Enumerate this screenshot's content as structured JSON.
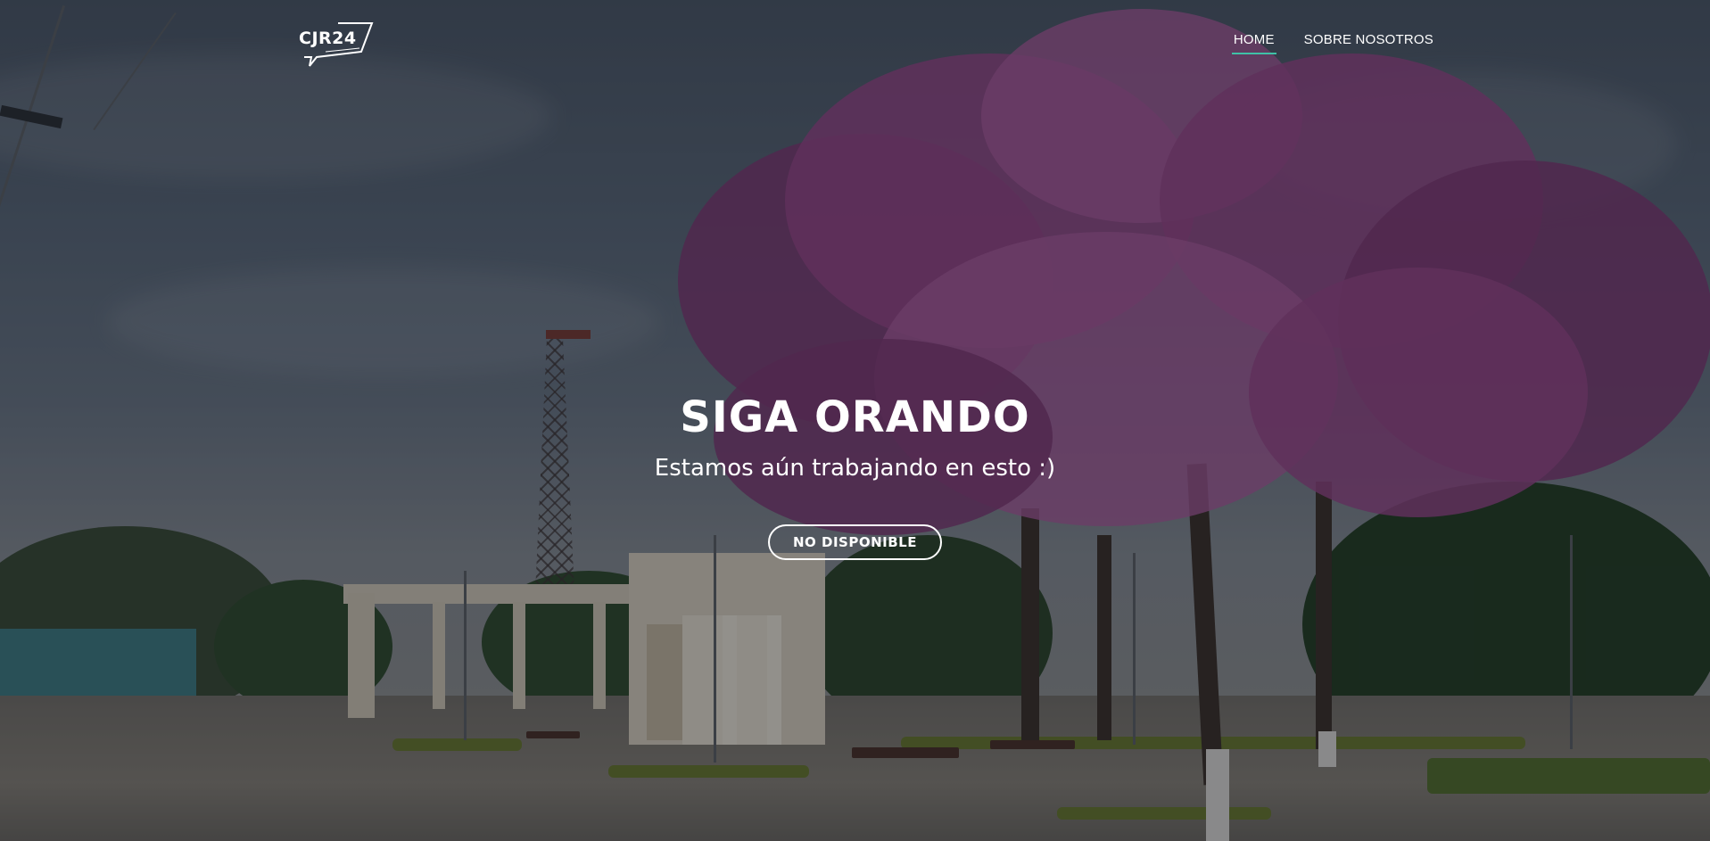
{
  "brand": {
    "logo_text": "CJR24"
  },
  "nav": {
    "items": [
      {
        "label": "HOME",
        "active": true
      },
      {
        "label": "SOBRE NOSOTROS",
        "active": false
      }
    ]
  },
  "hero": {
    "title": "SIGA ORANDO",
    "subtitle": "Estamos aún trabajando en esto :)",
    "cta_label": "NO DISPONIBLE"
  },
  "colors": {
    "accent": "#3fc1a7",
    "overlay": "rgba(12,16,24,0.42)"
  }
}
